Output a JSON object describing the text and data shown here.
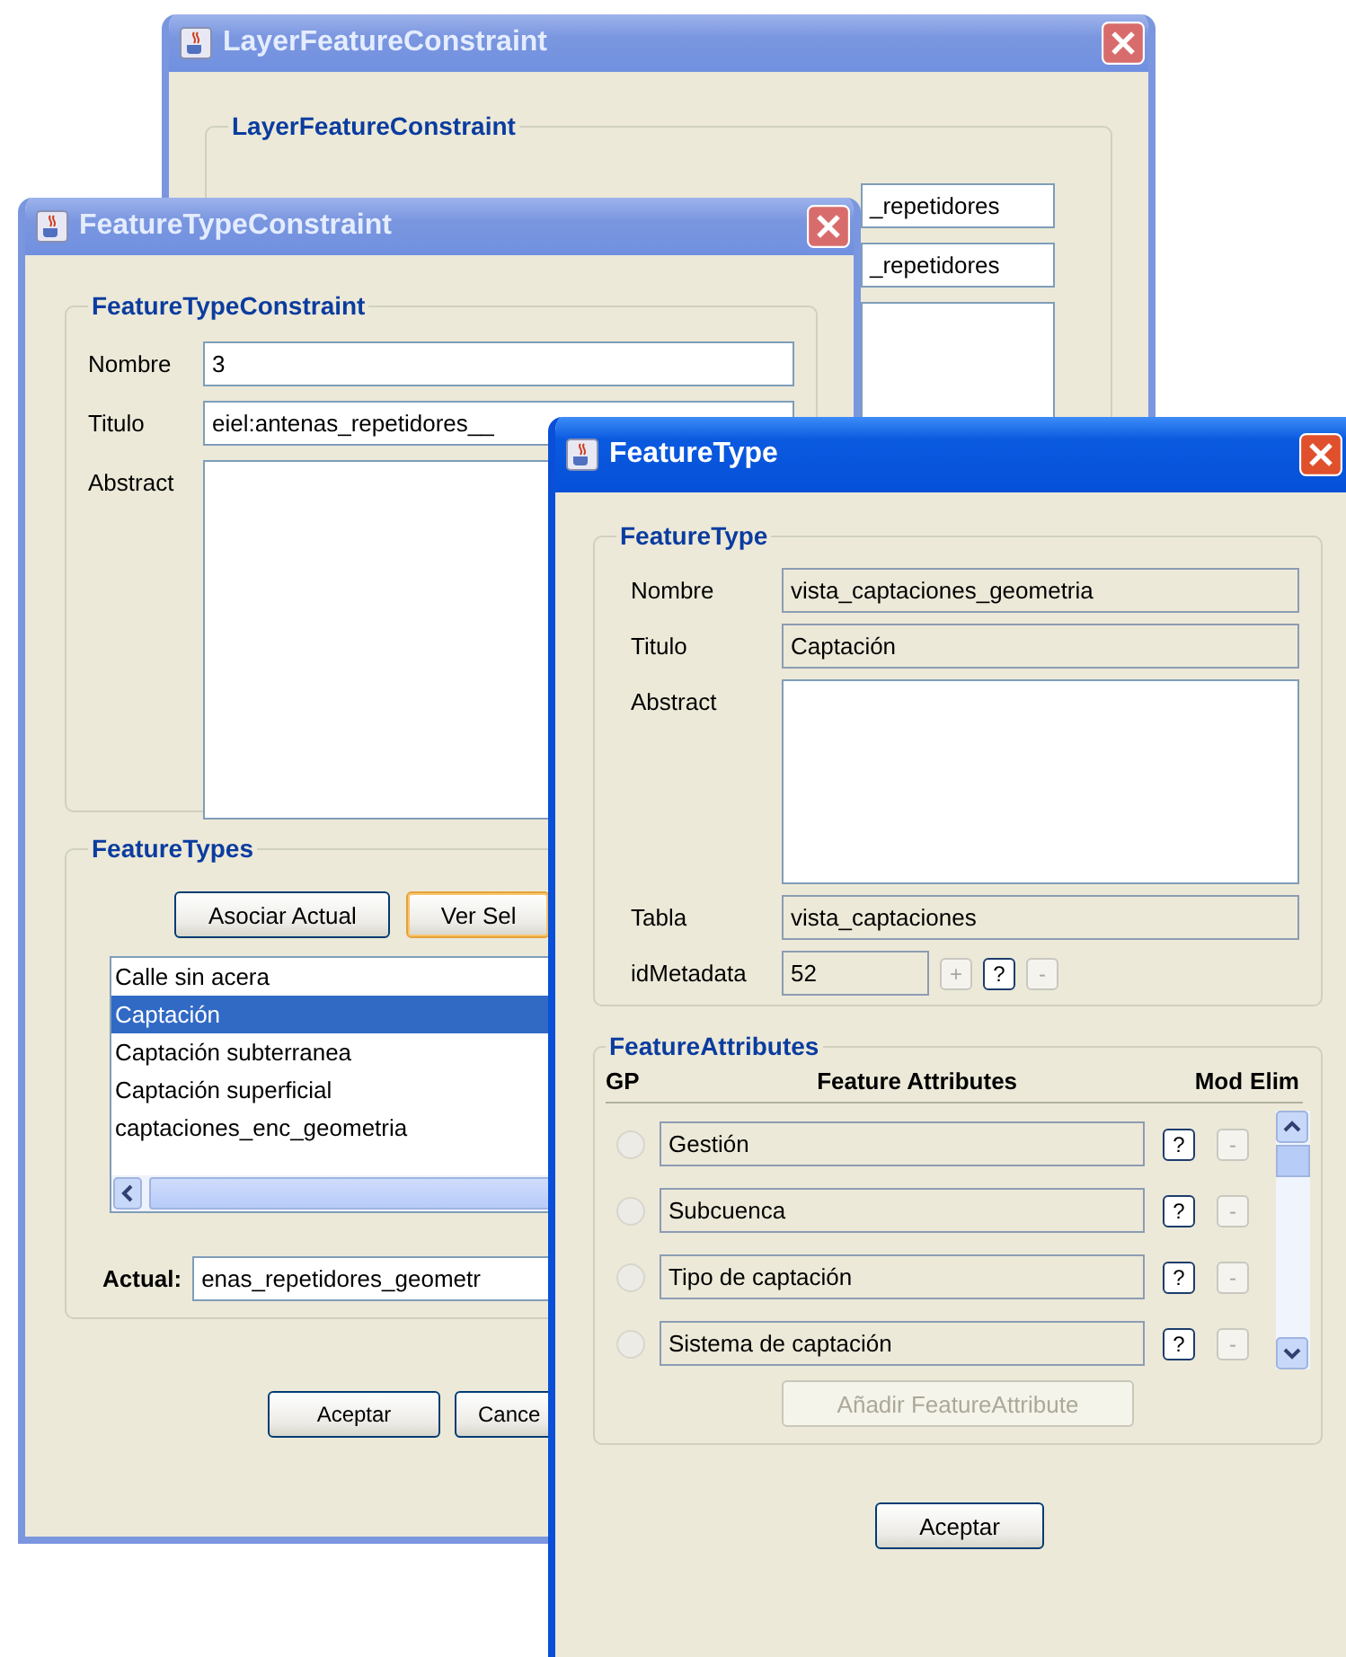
{
  "layer_window": {
    "title": "LayerFeatureConstraint",
    "active": false,
    "group_title": "LayerFeatureConstraint",
    "fields": [
      "_repetidores",
      "_repetidores"
    ]
  },
  "type_constraint_window": {
    "title": "FeatureTypeConstraint",
    "active": false,
    "group_title": "FeatureTypeConstraint",
    "nombre": {
      "label": "Nombre",
      "value": "3"
    },
    "titulo": {
      "label": "Titulo",
      "value": "eiel:antenas_repetidores__"
    },
    "abstract": {
      "label": "Abstract"
    },
    "featuretypes": {
      "title": "FeatureTypes",
      "buttons": [
        {
          "label": "Asociar Actual",
          "focused": false
        },
        {
          "label": "Ver Sel",
          "focused": true
        }
      ],
      "items": [
        {
          "label": "Calle sin acera",
          "selected": false
        },
        {
          "label": "Captación",
          "selected": true
        },
        {
          "label": "Captación subterranea",
          "selected": false
        },
        {
          "label": "Captación superficial",
          "selected": false
        },
        {
          "label": "captaciones_enc_geometria",
          "selected": false
        }
      ],
      "actual": {
        "label": "Actual:",
        "value": "enas_repetidores_geometr"
      }
    },
    "buttons": [
      "Aceptar",
      "Cance"
    ]
  },
  "feature_type_window": {
    "title": "FeatureType",
    "active": true,
    "group_title": "FeatureType",
    "fields": [
      {
        "label": "Nombre",
        "value": "vista_captaciones_geometria",
        "kind": "text"
      },
      {
        "label": "Titulo",
        "value": "Captación",
        "kind": "text"
      },
      {
        "label": "Abstract",
        "kind": "area"
      },
      {
        "label": "Tabla",
        "value": "vista_captaciones",
        "kind": "text"
      }
    ],
    "id_metadata": {
      "label": "idMetadata",
      "value": "52",
      "buttons": [
        {
          "label": "+",
          "disabled": true
        },
        {
          "label": "?",
          "disabled": false
        },
        {
          "label": "-",
          "disabled": true
        }
      ]
    },
    "attributes": {
      "title": "FeatureAttributes",
      "columns": [
        "GP",
        "Feature Attributes",
        "Mod",
        "Elim"
      ],
      "rows": [
        {
          "name": "Gestión",
          "selected": false,
          "mod": "?",
          "elim": "-"
        },
        {
          "name": "Subcuenca",
          "selected": false,
          "mod": "?",
          "elim": "-"
        },
        {
          "name": "Tipo de captación",
          "selected": false,
          "mod": "?",
          "elim": "-"
        },
        {
          "name": "Sistema de captación",
          "selected": false,
          "mod": "?",
          "elim": "-"
        }
      ],
      "add_button": {
        "label": "Añadir FeatureAttribute",
        "disabled": true
      }
    },
    "buttons": [
      "Aceptar"
    ]
  }
}
